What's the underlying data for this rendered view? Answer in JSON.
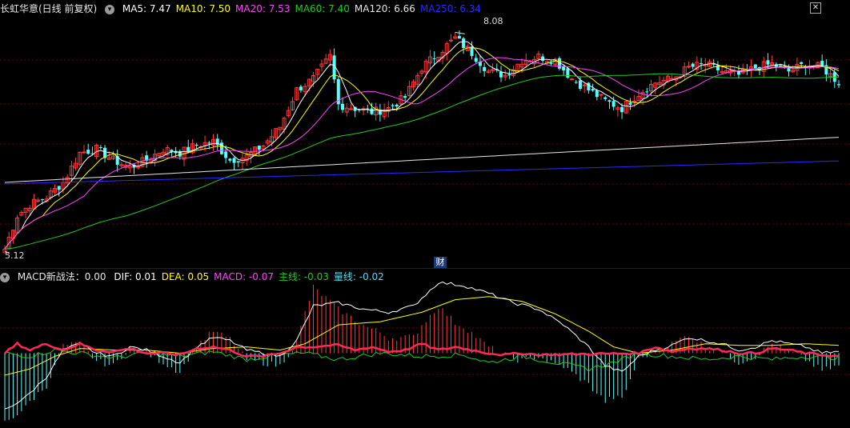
{
  "header": {
    "stock_title": "长虹华意(日线 前复权)",
    "dropdown_icon": "chevron-down-icon",
    "ma_labels": [
      {
        "text": "MA5: 7.47",
        "color": "#ffffff"
      },
      {
        "text": "MA10: 7.50",
        "color": "#ffff00"
      },
      {
        "text": "MA20: 7.53",
        "color": "#ff44ff"
      },
      {
        "text": "MA60: 7.40",
        "color": "#22cc22"
      },
      {
        "text": "MA120: 6.66",
        "color": "#e6e6e6"
      },
      {
        "text": "MA250: 6.34",
        "color": "#2a2aff"
      }
    ]
  },
  "macd_header": {
    "title": "MACD新战法：0.00",
    "labels": [
      {
        "text": "DIF: 0.01",
        "color": "#ffffff"
      },
      {
        "text": "DEA: 0.05",
        "color": "#ffff00"
      },
      {
        "text": "MACD: -0.07",
        "color": "#ff44ff"
      },
      {
        "text": "主线: -0.03",
        "color": "#22cc22"
      },
      {
        "text": "量线: -0.02",
        "color": "#55ddee"
      }
    ]
  },
  "markers": {
    "high": "8.08",
    "low": "5.12",
    "badge": "财"
  },
  "colors": {
    "up": "#ff3b3b",
    "down": "#54ffff",
    "grid": "#6b0000",
    "ma5": "#ffffff",
    "ma10": "#ffff00",
    "ma20": "#ff44ff",
    "ma60": "#22cc22",
    "ma120": "#e6e6e6",
    "ma250": "#2a2aff",
    "dif": "#ffffff",
    "dea": "#ffff00",
    "zhu": "#22cc22",
    "liang": "#ff2a5a"
  },
  "chart_data": [
    {
      "type": "candlestick",
      "ylim": [
        5.0,
        8.3
      ],
      "close_anchors": [
        [
          0,
          5.15
        ],
        [
          3,
          5.6
        ],
        [
          6,
          5.75
        ],
        [
          10,
          5.85
        ],
        [
          14,
          6.05
        ],
        [
          18,
          6.45
        ],
        [
          22,
          6.5
        ],
        [
          26,
          6.35
        ],
        [
          30,
          6.25
        ],
        [
          34,
          6.35
        ],
        [
          38,
          6.5
        ],
        [
          42,
          6.45
        ],
        [
          46,
          6.55
        ],
        [
          50,
          6.6
        ],
        [
          54,
          6.35
        ],
        [
          58,
          6.4
        ],
        [
          62,
          6.55
        ],
        [
          66,
          6.8
        ],
        [
          70,
          7.3
        ],
        [
          74,
          7.45
        ],
        [
          78,
          7.75
        ],
        [
          80,
          7.1
        ],
        [
          84,
          7.05
        ],
        [
          88,
          7.0
        ],
        [
          92,
          7.05
        ],
        [
          96,
          7.2
        ],
        [
          100,
          7.6
        ],
        [
          104,
          7.8
        ],
        [
          108,
          8.0
        ],
        [
          112,
          7.8
        ],
        [
          116,
          7.55
        ],
        [
          120,
          7.5
        ],
        [
          124,
          7.7
        ],
        [
          128,
          7.75
        ],
        [
          132,
          7.7
        ],
        [
          136,
          7.45
        ],
        [
          140,
          7.3
        ],
        [
          144,
          7.15
        ],
        [
          148,
          7.05
        ],
        [
          152,
          7.25
        ],
        [
          156,
          7.4
        ],
        [
          160,
          7.45
        ],
        [
          164,
          7.6
        ],
        [
          168,
          7.65
        ],
        [
          172,
          7.55
        ],
        [
          176,
          7.5
        ],
        [
          180,
          7.6
        ],
        [
          184,
          7.65
        ],
        [
          188,
          7.55
        ],
        [
          192,
          7.65
        ],
        [
          196,
          7.6
        ],
        [
          200,
          7.4
        ]
      ],
      "ma250_range": [
        6.34,
        6.34
      ],
      "series": [
        {
          "name": "MA5",
          "value": 7.47
        },
        {
          "name": "MA10",
          "value": 7.5
        },
        {
          "name": "MA20",
          "value": 7.53
        },
        {
          "name": "MA60",
          "value": 7.4
        },
        {
          "name": "MA120",
          "value": 6.66
        },
        {
          "name": "MA250",
          "value": 6.34
        }
      ],
      "high": 8.08,
      "low": 5.12
    },
    {
      "type": "line",
      "ylim": [
        -0.45,
        0.45
      ],
      "dif_anchors": [
        [
          0,
          -0.36
        ],
        [
          5,
          -0.28
        ],
        [
          10,
          -0.15
        ],
        [
          14,
          0.02
        ],
        [
          18,
          0.06
        ],
        [
          22,
          0.0
        ],
        [
          26,
          -0.02
        ],
        [
          30,
          0.04
        ],
        [
          34,
          0.02
        ],
        [
          38,
          -0.02
        ],
        [
          42,
          -0.06
        ],
        [
          46,
          0.04
        ],
        [
          50,
          0.1
        ],
        [
          54,
          0.08
        ],
        [
          58,
          0.02
        ],
        [
          62,
          0.0
        ],
        [
          66,
          -0.02
        ],
        [
          70,
          0.08
        ],
        [
          74,
          0.3
        ],
        [
          80,
          0.32
        ],
        [
          86,
          0.28
        ],
        [
          92,
          0.26
        ],
        [
          98,
          0.3
        ],
        [
          104,
          0.45
        ],
        [
          110,
          0.43
        ],
        [
          116,
          0.38
        ],
        [
          122,
          0.32
        ],
        [
          128,
          0.28
        ],
        [
          134,
          0.18
        ],
        [
          140,
          0.04
        ],
        [
          144,
          -0.08
        ],
        [
          148,
          -0.12
        ],
        [
          152,
          -0.02
        ],
        [
          156,
          0.02
        ],
        [
          160,
          0.05
        ],
        [
          164,
          0.1
        ],
        [
          168,
          0.08
        ],
        [
          172,
          0.06
        ],
        [
          176,
          0.02
        ],
        [
          180,
          0.04
        ],
        [
          184,
          0.08
        ],
        [
          188,
          0.06
        ],
        [
          192,
          0.04
        ],
        [
          196,
          0.0
        ],
        [
          200,
          0.01
        ]
      ],
      "dea_anchors": [
        [
          0,
          -0.14
        ],
        [
          6,
          -0.1
        ],
        [
          12,
          -0.02
        ],
        [
          18,
          0.03
        ],
        [
          26,
          0.02
        ],
        [
          34,
          0.02
        ],
        [
          42,
          0.0
        ],
        [
          50,
          0.03
        ],
        [
          58,
          0.04
        ],
        [
          66,
          0.02
        ],
        [
          72,
          0.06
        ],
        [
          80,
          0.18
        ],
        [
          90,
          0.2
        ],
        [
          100,
          0.26
        ],
        [
          108,
          0.34
        ],
        [
          116,
          0.36
        ],
        [
          124,
          0.33
        ],
        [
          132,
          0.25
        ],
        [
          140,
          0.14
        ],
        [
          146,
          0.04
        ],
        [
          152,
          0.0
        ],
        [
          160,
          0.02
        ],
        [
          168,
          0.06
        ],
        [
          176,
          0.05
        ],
        [
          184,
          0.05
        ],
        [
          192,
          0.06
        ],
        [
          200,
          0.05
        ]
      ],
      "zhu_anchors": [
        [
          0,
          0.0
        ],
        [
          6,
          -0.02
        ],
        [
          12,
          0.02
        ],
        [
          18,
          0.0
        ],
        [
          26,
          -0.03
        ],
        [
          34,
          0.0
        ],
        [
          42,
          -0.02
        ],
        [
          50,
          0.01
        ],
        [
          58,
          -0.04
        ],
        [
          66,
          -0.01
        ],
        [
          72,
          0.0
        ],
        [
          80,
          -0.04
        ],
        [
          90,
          0.0
        ],
        [
          100,
          -0.02
        ],
        [
          110,
          -0.01
        ],
        [
          116,
          -0.06
        ],
        [
          124,
          -0.02
        ],
        [
          132,
          -0.06
        ],
        [
          140,
          -0.1
        ],
        [
          146,
          -0.06
        ],
        [
          152,
          0.0
        ],
        [
          160,
          -0.02
        ],
        [
          168,
          -0.04
        ],
        [
          176,
          -0.02
        ],
        [
          184,
          -0.04
        ],
        [
          192,
          -0.02
        ],
        [
          200,
          -0.03
        ]
      ],
      "liang_anchors": [
        [
          0,
          0.0
        ],
        [
          3,
          0.06
        ],
        [
          6,
          0.02
        ],
        [
          10,
          0.06
        ],
        [
          14,
          0.02
        ],
        [
          18,
          0.06
        ],
        [
          22,
          0.02
        ],
        [
          26,
          0.01
        ],
        [
          30,
          0.03
        ],
        [
          34,
          0.0
        ],
        [
          38,
          0.0
        ],
        [
          42,
          -0.01
        ],
        [
          46,
          0.03
        ],
        [
          50,
          0.04
        ],
        [
          54,
          0.02
        ],
        [
          58,
          -0.02
        ],
        [
          62,
          -0.02
        ],
        [
          66,
          0.0
        ],
        [
          70,
          0.04
        ],
        [
          74,
          0.04
        ],
        [
          78,
          0.05
        ],
        [
          80,
          0.05
        ],
        [
          84,
          0.02
        ],
        [
          88,
          0.04
        ],
        [
          92,
          0.01
        ],
        [
          96,
          0.02
        ],
        [
          100,
          0.06
        ],
        [
          104,
          0.02
        ],
        [
          108,
          0.04
        ],
        [
          112,
          0.02
        ],
        [
          116,
          0.0
        ],
        [
          120,
          -0.01
        ],
        [
          124,
          0.0
        ],
        [
          128,
          -0.01
        ],
        [
          152,
          0.0
        ],
        [
          156,
          0.04
        ],
        [
          160,
          0.01
        ],
        [
          164,
          0.03
        ],
        [
          168,
          0.03
        ],
        [
          172,
          0.02
        ],
        [
          176,
          0.0
        ],
        [
          180,
          0.0
        ],
        [
          184,
          0.03
        ],
        [
          188,
          0.02
        ],
        [
          192,
          0.0
        ],
        [
          196,
          -0.01
        ],
        [
          200,
          -0.02
        ]
      ],
      "series": [
        {
          "name": "DIF",
          "value": 0.01
        },
        {
          "name": "DEA",
          "value": 0.05
        },
        {
          "name": "MACD",
          "value": -0.07
        },
        {
          "name": "主线",
          "value": -0.03
        },
        {
          "name": "量线",
          "value": -0.02
        }
      ]
    }
  ]
}
